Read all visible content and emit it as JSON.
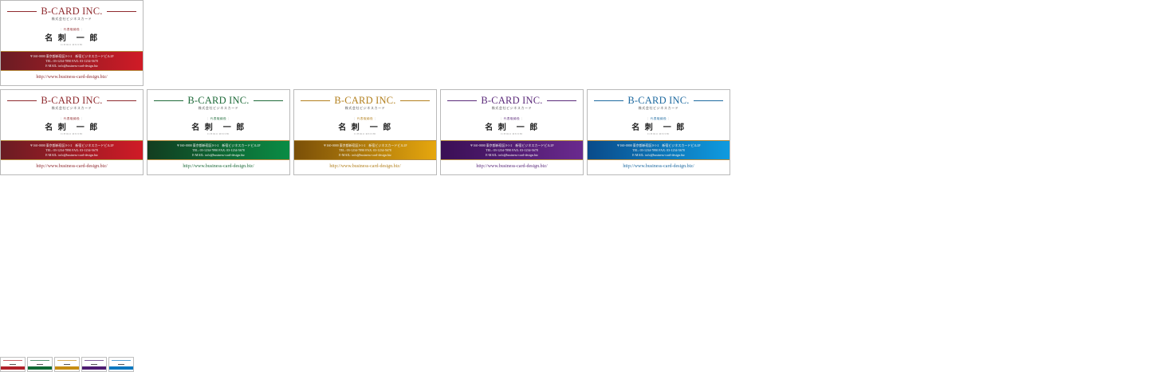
{
  "card_text": {
    "brand": "B-CARD INC.",
    "company": "株式会社ビジネスカード",
    "title": "代表取締役",
    "name": "名 刺　一 郎",
    "romaji": "ICHIRO  MEISHI",
    "address": "〒160-0000  東京都新宿区0-1-2　新宿ビジネスカードビル2F",
    "tel": "TEL: 03-1234-7890    FAX: 03-1234-5678",
    "email": "E-MAIL: info@business-card-design.biz",
    "url": "http://www.business-card-design.biz/"
  },
  "cards": [
    {
      "id": "top-red",
      "variant": "red",
      "accent": "#8f2a2e",
      "band_from": "#6a1c23",
      "band_to": "#d01b26"
    },
    {
      "id": "red",
      "variant": "red",
      "accent": "#8f2a2e",
      "band_from": "#6a1c23",
      "band_to": "#d01b26"
    },
    {
      "id": "green",
      "variant": "green",
      "accent": "#1f6b3a",
      "band_from": "#123d20",
      "band_to": "#0a8c45"
    },
    {
      "id": "gold",
      "variant": "gold",
      "accent": "#b3801e",
      "band_from": "#7a4f08",
      "band_to": "#e6a70e"
    },
    {
      "id": "purple",
      "variant": "purple",
      "accent": "#5b2a7a",
      "band_from": "#3a0f55",
      "band_to": "#6a2a8e"
    },
    {
      "id": "blue",
      "variant": "blue",
      "accent": "#1e6aa0",
      "band_from": "#0a4b8a",
      "band_to": "#0f9be0"
    }
  ],
  "thumbnails": [
    {
      "variant": "red",
      "accent": "#b0202a"
    },
    {
      "variant": "green",
      "accent": "#0f6a34"
    },
    {
      "variant": "gold",
      "accent": "#c78d12"
    },
    {
      "variant": "purple",
      "accent": "#4e1c72"
    },
    {
      "variant": "blue",
      "accent": "#0b78c0"
    }
  ]
}
